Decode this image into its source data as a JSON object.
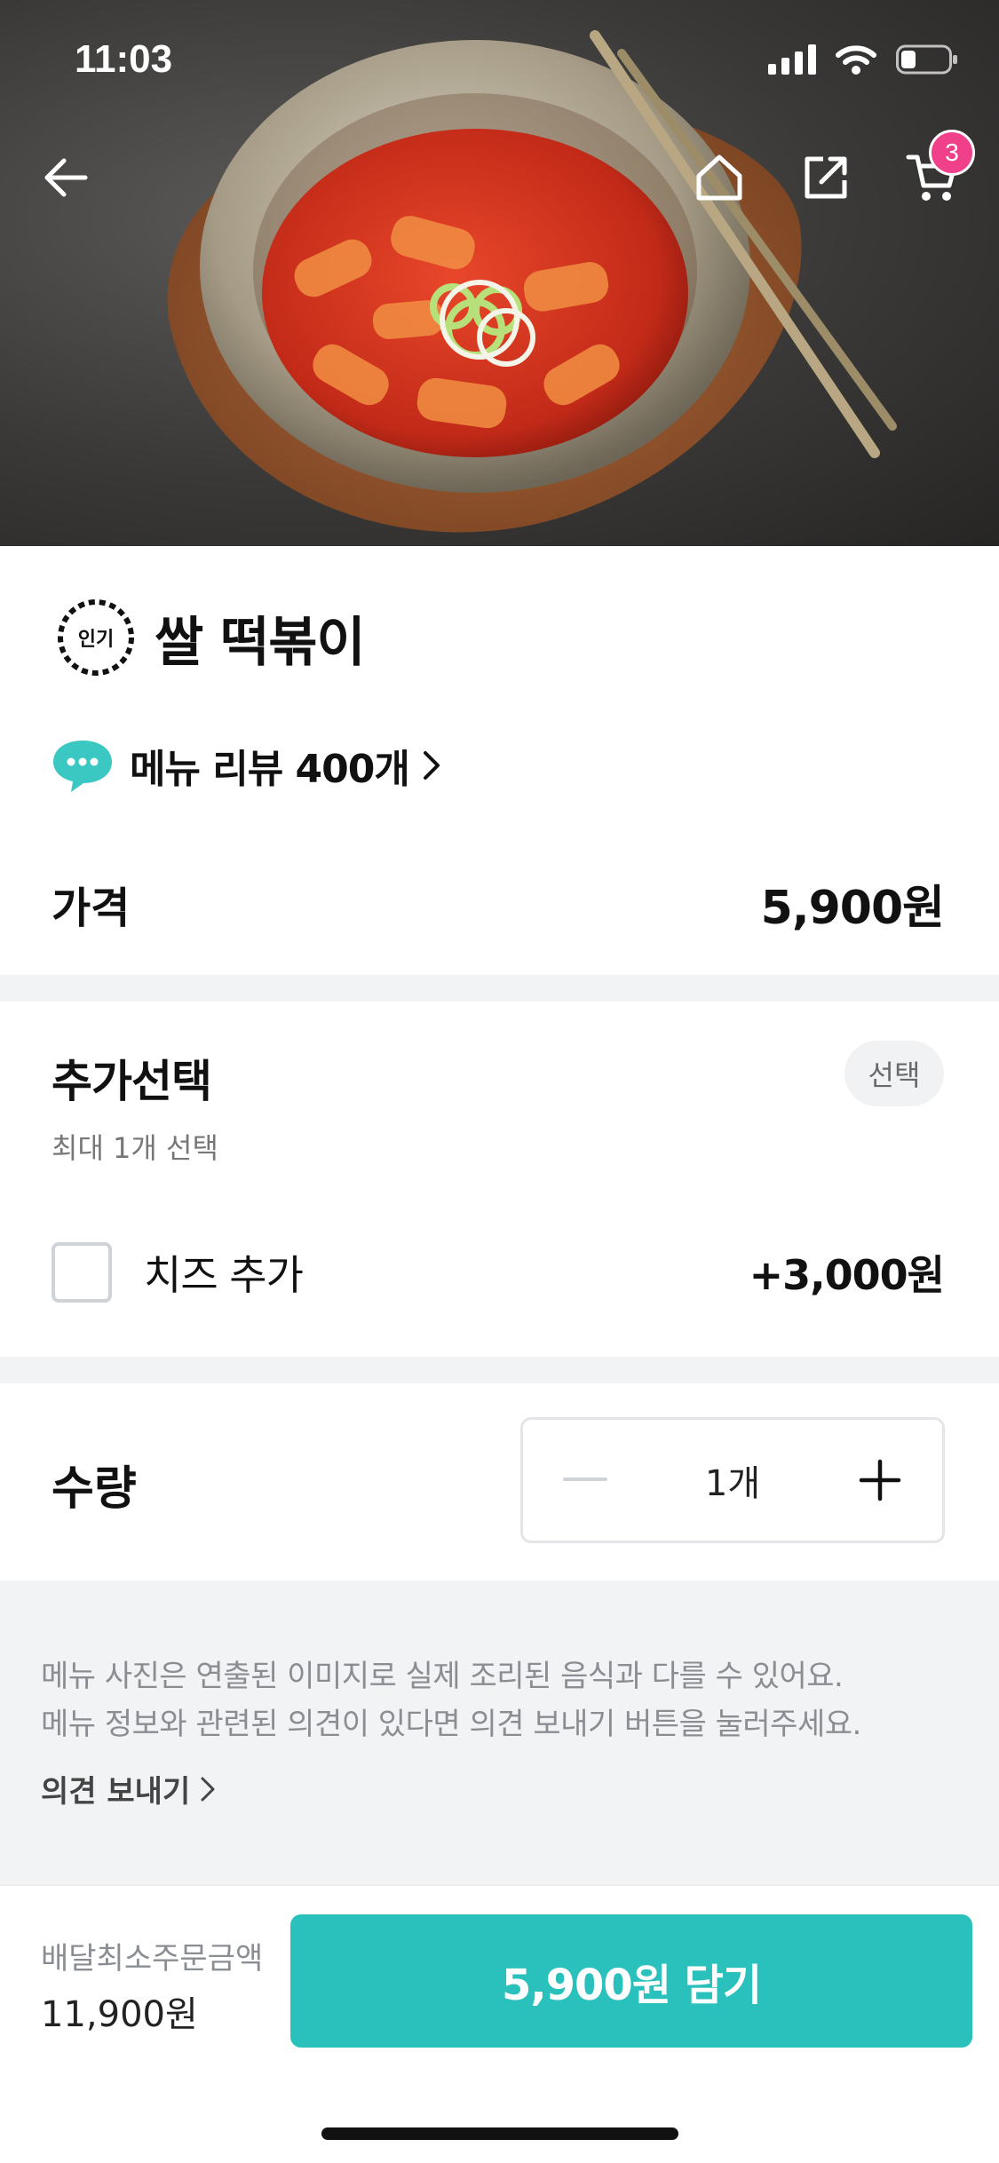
{
  "status": {
    "time": "11:03"
  },
  "header": {
    "cart_count": "3"
  },
  "menu": {
    "badge": "인기",
    "title": "쌀 떡볶이",
    "review": "메뉴 리뷰 400개",
    "price_label": "가격",
    "price": "5,900원"
  },
  "options": {
    "title": "추가선택",
    "subtitle": "최대 1개 선택",
    "tag": "선택",
    "items": [
      {
        "name": "치즈 추가",
        "price": "+3,000원",
        "checked": false
      }
    ]
  },
  "quantity": {
    "label": "수량",
    "value": "1개"
  },
  "notice": {
    "line1": "메뉴 사진은 연출된 이미지로 실제 조리된 음식과 다를 수 있어요.",
    "line2": "메뉴 정보와 관련된 의견이 있다면 의견 보내기 버튼을 눌러주세요.",
    "feedback_link": "의견 보내기"
  },
  "bottom": {
    "min_label": "배달최소주문금액",
    "min_value": "11,900원",
    "cta": "5,900원 담기"
  },
  "colors": {
    "accent": "#2ac1bc",
    "badge": "#f0408a",
    "divider": "#f2f3f5"
  },
  "icons": [
    "back-arrow-icon",
    "home-icon",
    "share-icon",
    "cart-icon",
    "chat-bubble-icon",
    "chevron-right-icon",
    "minus-icon",
    "plus-icon"
  ]
}
